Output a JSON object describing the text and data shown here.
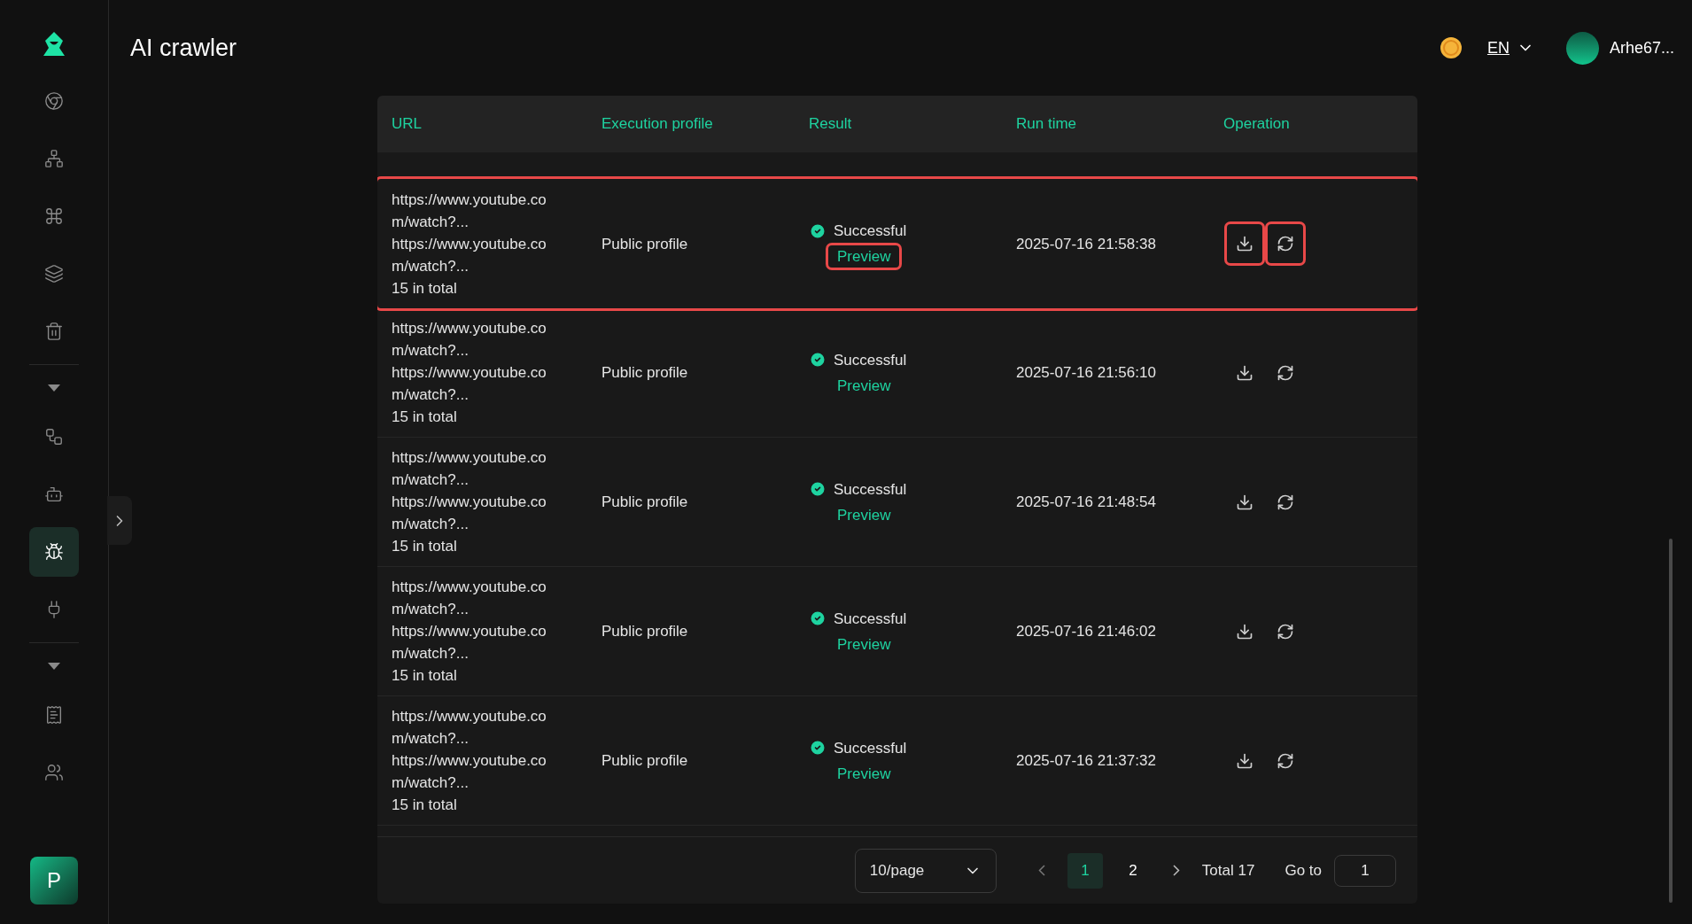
{
  "header": {
    "title": "AI crawler",
    "language": "EN",
    "user": "Arhe67..."
  },
  "sidebar": {
    "groups": [
      {
        "collapsible": false,
        "items": [
          {
            "kind": "chrome",
            "selected": false
          },
          {
            "kind": "sitemap",
            "selected": false
          },
          {
            "kind": "command",
            "selected": false
          },
          {
            "kind": "layers",
            "selected": false
          },
          {
            "kind": "bucket",
            "selected": false
          }
        ]
      },
      {
        "collapsible": true,
        "items": [
          {
            "kind": "flow",
            "selected": false
          },
          {
            "kind": "bot",
            "selected": false
          },
          {
            "kind": "bug",
            "selected": true
          },
          {
            "kind": "plug",
            "selected": false
          }
        ]
      },
      {
        "collapsible": true,
        "items": [
          {
            "kind": "notes",
            "selected": false
          },
          {
            "kind": "users",
            "selected": false
          }
        ]
      }
    ],
    "profile_initial": "P"
  },
  "table": {
    "columns": [
      "URL",
      "Execution profile",
      "Result",
      "Run time",
      "Operation"
    ],
    "rows": [
      {
        "urls": [
          "https://www.youtube.com/watch?...",
          "https://www.youtube.com/watch?..."
        ],
        "count": "15 in total",
        "profile": "Public profile",
        "result": "Successful",
        "link": "Preview",
        "run_time": "2025-07-16 21:58:38",
        "highlighted": true
      },
      {
        "urls": [
          "https://www.youtube.com/watch?...",
          "https://www.youtube.com/watch?..."
        ],
        "count": "15 in total",
        "profile": "Public profile",
        "result": "Successful",
        "link": "Preview",
        "run_time": "2025-07-16 21:56:10",
        "highlighted": false
      },
      {
        "urls": [
          "https://www.youtube.com/watch?...",
          "https://www.youtube.com/watch?..."
        ],
        "count": "15 in total",
        "profile": "Public profile",
        "result": "Successful",
        "link": "Preview",
        "run_time": "2025-07-16 21:48:54",
        "highlighted": false
      },
      {
        "urls": [
          "https://www.youtube.com/watch?...",
          "https://www.youtube.com/watch?..."
        ],
        "count": "15 in total",
        "profile": "Public profile",
        "result": "Successful",
        "link": "Preview",
        "run_time": "2025-07-16 21:46:02",
        "highlighted": false
      },
      {
        "urls": [
          "https://www.youtube.com/watch?...",
          "https://www.youtube.com/watch?..."
        ],
        "count": "15 in total",
        "profile": "Public profile",
        "result": "Successful",
        "link": "Preview",
        "run_time": "2025-07-16 21:37:32",
        "highlighted": false
      }
    ]
  },
  "pagination": {
    "page_size": "10/page",
    "pages": [
      {
        "label": "1",
        "selected": true
      },
      {
        "label": "2",
        "selected": false
      }
    ],
    "total": "Total 17",
    "goto_label": "Go to",
    "goto_value": "1"
  }
}
